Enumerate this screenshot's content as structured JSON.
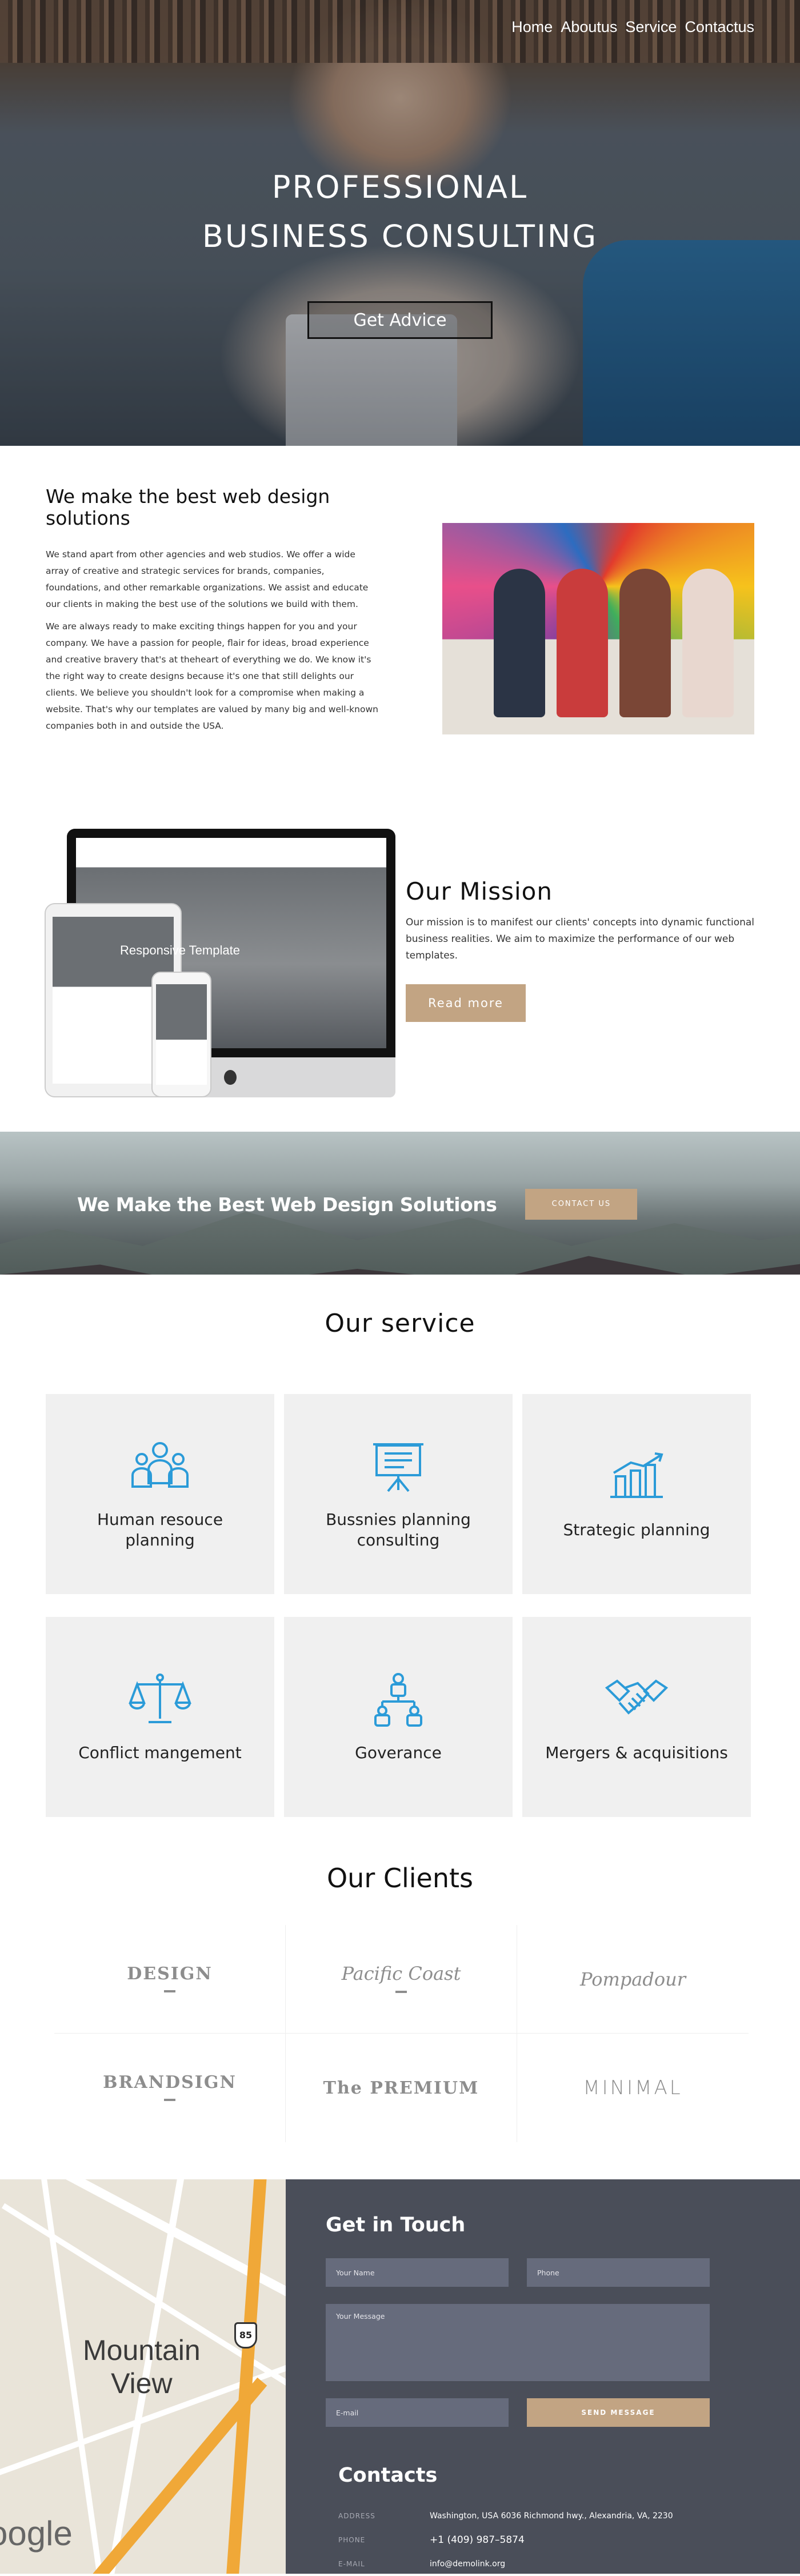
{
  "nav": {
    "items": [
      "Home",
      "Aboutus",
      "Service",
      "Contactus"
    ]
  },
  "hero": {
    "title_line1": "PROFESSIONAL",
    "title_line2": "BUSINESS CONSULTING",
    "button": "Get Advice"
  },
  "about": {
    "heading": "We make the best web design solutions",
    "p1": "We stand apart from other agencies and web studios. We offer a wide array of creative and strategic services for brands, companies, foundations, and other remarkable organizations. We assist and educate our clients in making the best use of the solutions we build with them.",
    "p2": "We are always ready to make exciting things happen for you and your company. We have a passion for people, flair for ideas, broad experience and creative bravery that's at theheart of everything we do. We know it's the right way to create designs because it's one that still delights our clients. We believe you shouldn't look for a compromise when making a website. That's why our templates are valued by many big and well-known companies both in and outside the USA."
  },
  "mission": {
    "heading": "Our Mission",
    "text": "Our mission is to manifest our clients' concepts into dynamic functional business realities. We aim to maximize the performance of our web templates.",
    "button": "Read more",
    "mockup_title": "Responsive Template"
  },
  "banner": {
    "title": "We Make the Best Web Design Solutions",
    "button": "CONTACT US"
  },
  "services": {
    "title": "Our service",
    "items": [
      {
        "label": "Human resouce planning",
        "icon": "team-icon"
      },
      {
        "label": "Bussnies planning consulting",
        "icon": "presentation-board-icon"
      },
      {
        "label": "Strategic planning",
        "icon": "growth-chart-icon"
      },
      {
        "label": "Conflict mangement",
        "icon": "scales-icon"
      },
      {
        "label": "Goverance",
        "icon": "hierarchy-icon"
      },
      {
        "label": "Mergers & acquisitions",
        "icon": "handshake-icon"
      }
    ]
  },
  "clients": {
    "title": "Our Clients",
    "logos": [
      "DESIGN",
      "Pacific Coast",
      "Pompadour",
      "BRANDSIGN",
      "The PREMIUM",
      "MINIMAL"
    ]
  },
  "contact": {
    "heading": "Get in Touch",
    "name_placeholder": "Your Name",
    "phone_placeholder": "Phone",
    "message_placeholder": "Your Message",
    "email_placeholder": "E-mail",
    "send": "SEND MESSAGE",
    "contacts_heading": "Contacts",
    "address_label": "ADDRESS",
    "address": "Washington, USA 6036 Richmond hwy., Alexandria, VA, 2230",
    "phone_label": "PHONE",
    "phone": "+1 (409) 987–5874",
    "email_label": "E-MAIL",
    "email": "info@demolink.org"
  },
  "map": {
    "label_line1": "Mountain",
    "label_line2": "View",
    "shield": "85",
    "google": "oogle"
  },
  "colors": {
    "accent": "#c2a483",
    "service_icon": "#2b9bd8",
    "panel": "#4a4e59"
  }
}
